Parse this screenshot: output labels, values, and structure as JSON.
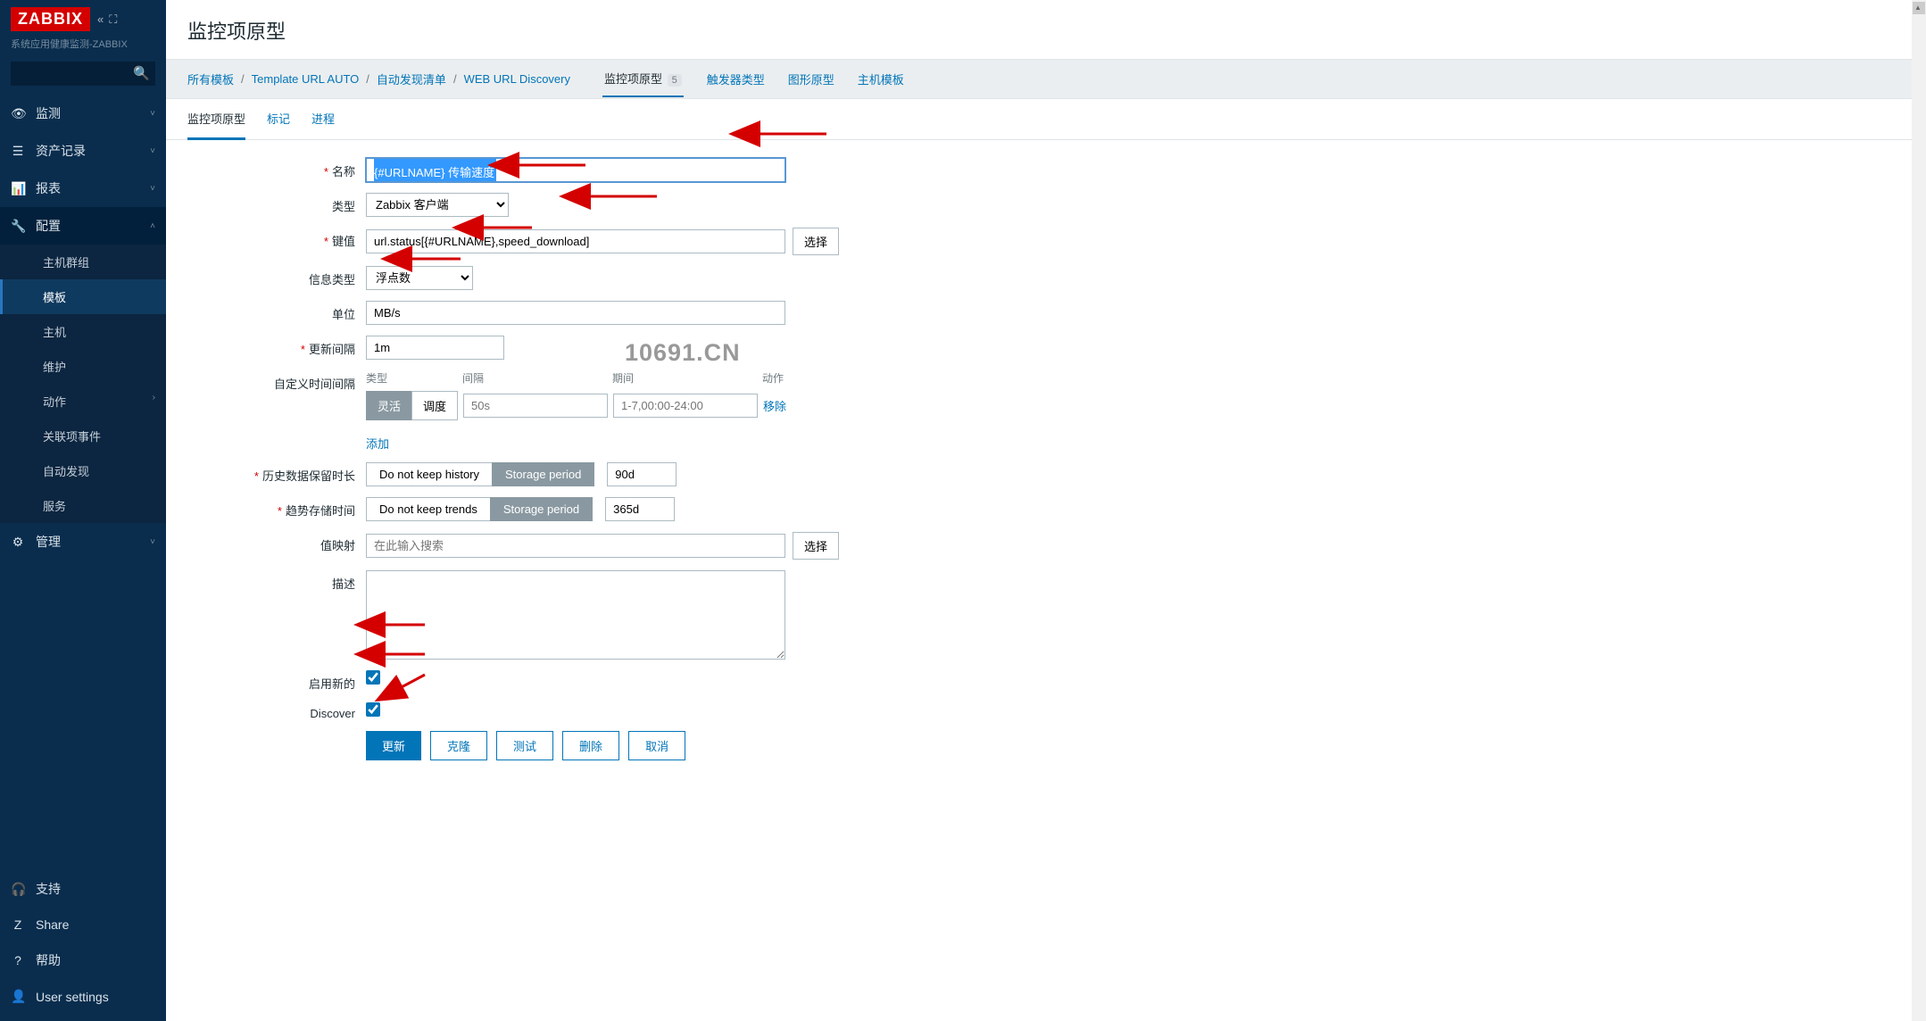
{
  "logo": "ZABBIX",
  "logo_sub": "系统应用健康监测-ZABBIX",
  "search_placeholder": "",
  "sidebar": {
    "items": [
      {
        "icon": "eye",
        "label": "监测",
        "expand": true
      },
      {
        "icon": "list",
        "label": "资产记录",
        "expand": true
      },
      {
        "icon": "chart",
        "label": "报表",
        "expand": true
      },
      {
        "icon": "wrench",
        "label": "配置",
        "expand": true,
        "expanded": true,
        "subs": [
          {
            "label": "主机群组"
          },
          {
            "label": "模板",
            "active": true
          },
          {
            "label": "主机"
          },
          {
            "label": "维护"
          },
          {
            "label": "动作",
            "arrow": true
          },
          {
            "label": "关联项事件"
          },
          {
            "label": "自动发现"
          },
          {
            "label": "服务"
          }
        ]
      },
      {
        "icon": "gear",
        "label": "管理",
        "expand": true
      }
    ],
    "bottom": [
      {
        "icon": "headset",
        "label": "支持"
      },
      {
        "icon": "z",
        "label": "Share"
      },
      {
        "icon": "help",
        "label": "帮助"
      },
      {
        "icon": "user",
        "label": "User settings"
      }
    ]
  },
  "page_title": "监控项原型",
  "breadcrumb": {
    "links": [
      {
        "label": "所有模板"
      },
      {
        "label": "Template URL AUTO"
      },
      {
        "label": "自动发现清单"
      },
      {
        "label": "WEB URL Discovery"
      }
    ],
    "tabs": [
      {
        "label": "监控项原型",
        "count": "5",
        "active": true
      },
      {
        "label": "触发器类型"
      },
      {
        "label": "图形原型"
      },
      {
        "label": "主机模板"
      }
    ]
  },
  "tabs": [
    {
      "label": "监控项原型",
      "active": true
    },
    {
      "label": "标记"
    },
    {
      "label": "进程"
    }
  ],
  "form": {
    "name": {
      "label": "名称",
      "value": "{#URLNAME} 传输速度",
      "required": true
    },
    "type": {
      "label": "类型",
      "value": "Zabbix 客户端"
    },
    "key": {
      "label": "键值",
      "value": "url.status[{#URLNAME},speed_download]",
      "required": true,
      "btn": "选择"
    },
    "info_type": {
      "label": "信息类型",
      "value": "浮点数"
    },
    "units": {
      "label": "单位",
      "value": "MB/s"
    },
    "interval": {
      "label": "更新间隔",
      "value": "1m",
      "required": true
    },
    "custom_intervals": {
      "label": "自定义时间间隔",
      "headers": {
        "type": "类型",
        "interval": "间隔",
        "period": "期间",
        "action": "动作"
      },
      "row": {
        "btn_flexible": "灵活",
        "btn_scheduling": "调度",
        "interval_ph": "50s",
        "period_ph": "1-7,00:00-24:00",
        "remove": "移除"
      },
      "add": "添加"
    },
    "history": {
      "label": "历史数据保留时长",
      "required": true,
      "opt1": "Do not keep history",
      "opt2": "Storage period",
      "value": "90d"
    },
    "trends": {
      "label": "趋势存储时间",
      "required": true,
      "opt1": "Do not keep trends",
      "opt2": "Storage period",
      "value": "365d"
    },
    "valuemap": {
      "label": "值映射",
      "placeholder": "在此输入搜索",
      "btn": "选择"
    },
    "description": {
      "label": "描述"
    },
    "enable": {
      "label": "启用新的"
    },
    "discover": {
      "label": "Discover"
    }
  },
  "buttons": {
    "update": "更新",
    "clone": "克隆",
    "test": "测试",
    "delete": "删除",
    "cancel": "取消"
  },
  "watermark": "10691.CN"
}
